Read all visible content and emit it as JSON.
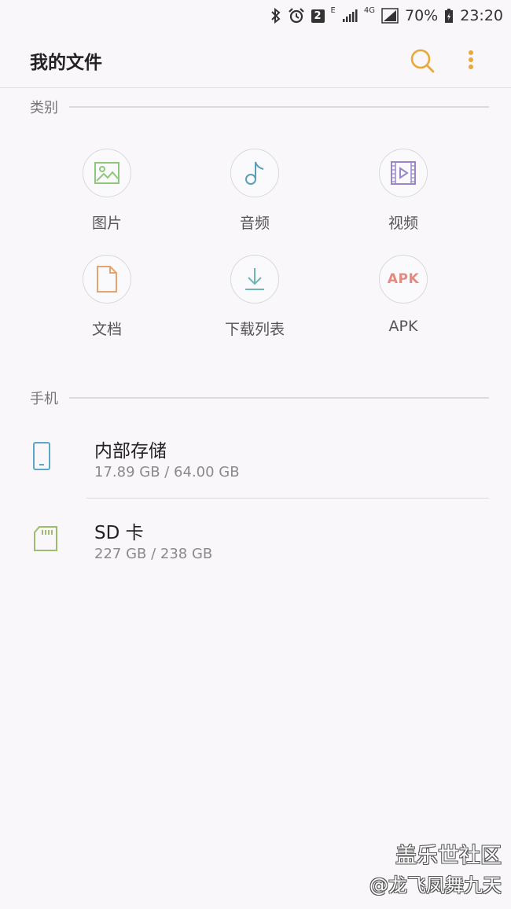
{
  "status_bar": {
    "notification_count": "2",
    "network_e": "E",
    "network_4g": "4G",
    "battery": "70%",
    "time": "23:20"
  },
  "app_bar": {
    "title": "我的文件"
  },
  "sections": {
    "categories": "类别",
    "phone": "手机"
  },
  "categories": [
    {
      "label": "图片",
      "icon": "image-icon",
      "color": "#8fc77a"
    },
    {
      "label": "音频",
      "icon": "music-note-icon",
      "color": "#5a9fb8"
    },
    {
      "label": "视频",
      "icon": "video-icon",
      "color": "#9a87c7"
    },
    {
      "label": "文档",
      "icon": "document-icon",
      "color": "#e5a36e"
    },
    {
      "label": "下载列表",
      "icon": "download-icon",
      "color": "#6cb7b1"
    },
    {
      "label": "APK",
      "icon": "apk-icon",
      "icon_text": "APK",
      "color": "#e38b7e"
    }
  ],
  "storage": [
    {
      "name": "内部存储",
      "size": "17.89 GB / 64.00 GB",
      "icon": "phone-icon",
      "color": "#5aa8c7"
    },
    {
      "name": "SD 卡",
      "size": "227 GB / 238 GB",
      "icon": "sd-card-icon",
      "color": "#9bbd6c"
    }
  ],
  "watermark": {
    "line1": "盖乐世社区",
    "line2": "@龙飞凤舞九天"
  },
  "colors": {
    "accent": "#e8a93a",
    "background": "#f9f7fa"
  }
}
